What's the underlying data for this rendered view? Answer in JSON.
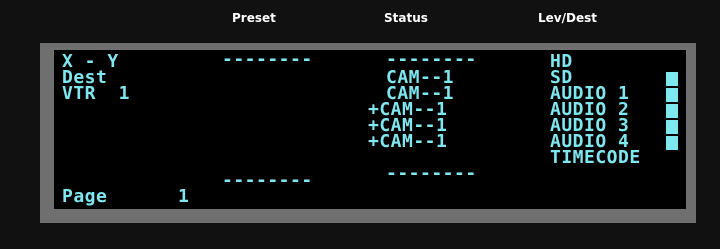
{
  "header": {
    "preset_label": "Preset",
    "status_label": "Status",
    "levdest_label": "Lev/Dest"
  },
  "display": {
    "left_lines": [
      "X - Y",
      "Dest",
      "VTR  1"
    ],
    "page_label": "Page",
    "page_number": "1",
    "preset_top": "--------",
    "preset_bottom": "--------",
    "status_lines": [
      "--------",
      "CAM--1",
      "CAM--1",
      "+CAM--1",
      "+CAM--1",
      "+CAM--1",
      "--------"
    ],
    "levels": [
      "HD",
      "SD",
      "AUDIO 1",
      "AUDIO 2",
      "AUDIO 3",
      "AUDIO 4",
      "TIMECODE"
    ],
    "indicator_levels": [
      "SD",
      "AUDIO 1",
      "AUDIO 2",
      "AUDIO 3",
      "AUDIO 4"
    ]
  },
  "colors": {
    "text": "#7fe7ef",
    "screen_bg": "#000000",
    "bezel": "#6f6f6f",
    "panel_bg": "#111111"
  }
}
